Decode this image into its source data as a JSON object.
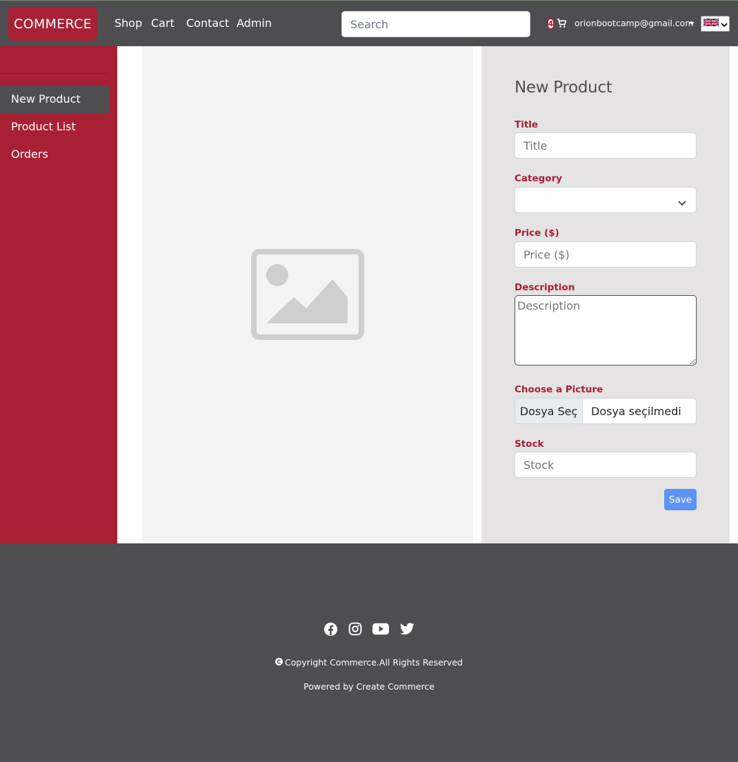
{
  "navbar": {
    "brand": "COMMERCE",
    "links": [
      "Shop",
      "Cart",
      "Contact",
      "Admin"
    ],
    "search_placeholder": "Search",
    "cart_count": "4",
    "user_email": "orionbootcamp@gmail.com",
    "language": "en-GB"
  },
  "sidebar": {
    "items": [
      {
        "label": "New Product",
        "active": true
      },
      {
        "label": "Product List",
        "active": false
      },
      {
        "label": "Orders",
        "active": false
      }
    ]
  },
  "form": {
    "title": "New Product",
    "fields": {
      "title": {
        "label": "Title",
        "placeholder": "Title"
      },
      "category": {
        "label": "Category",
        "value": ""
      },
      "price": {
        "label": "Price ($)",
        "placeholder": "Price ($)"
      },
      "description": {
        "label": "Description",
        "placeholder": "Description"
      },
      "picture": {
        "label": "Choose a Picture",
        "button": "Dosya Seç",
        "file_name": "Dosya seçilmedi"
      },
      "stock": {
        "label": "Stock",
        "placeholder": "Stock"
      }
    },
    "save_label": "Save"
  },
  "footer": {
    "social": [
      "facebook-icon",
      "instagram-icon",
      "youtube-icon",
      "twitter-icon"
    ],
    "copyright": "Copyright Commerce.All Rights Reserved",
    "powered": "Powered by Create Commerce"
  },
  "colors": {
    "brand_red": "#a82033",
    "dark_gray": "#4e4e50",
    "panel_gray": "#e5e3e4",
    "save_blue": "#5c93f5"
  }
}
